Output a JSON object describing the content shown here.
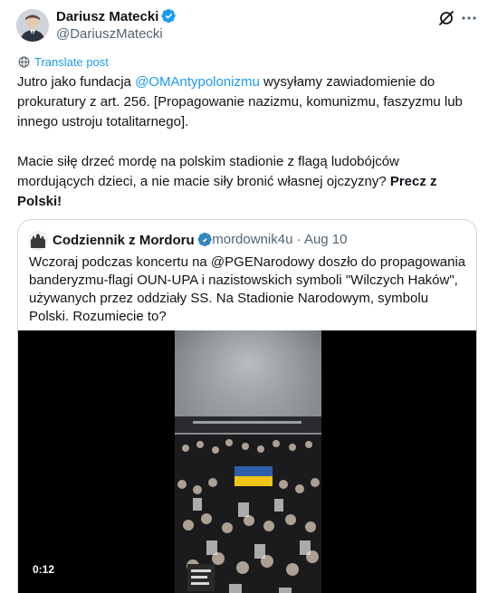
{
  "post": {
    "author_name": "Dariusz Matecki",
    "author_handle": "@DariuszMatecki",
    "translate_label": "Translate post",
    "text_intro": "Jutro jako fundacja ",
    "text_mention": "@OMAntypolonizmu",
    "text_rest": " wysyłamy zawiadomienie do prokuratury z art. 256. [Propagowanie nazizmu, komunizmu, faszyzmu lub innego ustroju totalitarnego].",
    "text_para2": "Macie siłę drzeć mordę na polskim stadionie z flagą ludobójców mordujących dzieci, a nie macie siły bronić własnej ojczyzny? ",
    "text_bold": "Precz z Polski!"
  },
  "quote": {
    "author_name": "Codziennik z Mordoru",
    "meta": "@mordownik4u · Aug 10",
    "text": "Wczoraj podczas koncertu na @PGENarodowy doszło do propagowania banderyzmu-flagi OUN-UPA i nazistowskich symboli \"Wilczych Haków\", używanych przez oddziały SS. Na Stadionie Narodowym, symbolu Polski. Rozumiecie to?",
    "video_duration": "0:12"
  },
  "icons": {
    "verified": "verified-badge-icon",
    "grok": "grok-icon",
    "more": "more-icon",
    "translate": "translate-globe-icon"
  },
  "colors": {
    "link": "#1d9bf0",
    "text": "#0f1419",
    "secondary": "#536471",
    "border": "#cfd9de",
    "flag_blue": "#2f5fa8",
    "flag_yellow": "#f2c417"
  }
}
